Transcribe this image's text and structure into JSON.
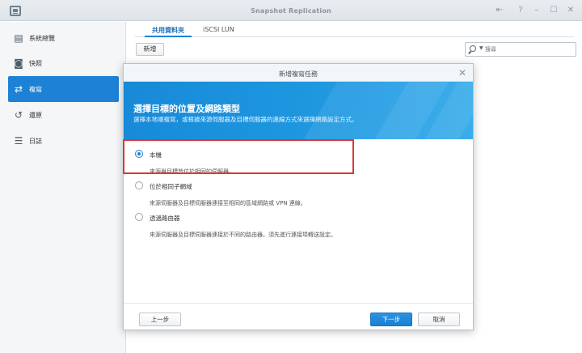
{
  "window": {
    "title": "Snapshot Replication",
    "controls": {
      "pin": "⇤",
      "help": "?",
      "minimize": "–",
      "maximize": "☐",
      "close": "✕"
    }
  },
  "sidebar": {
    "items": [
      {
        "label": "系統總覽",
        "icon": "overview-icon",
        "glyph": "▤",
        "active": false
      },
      {
        "label": "快照",
        "icon": "camera-icon",
        "glyph": "◙",
        "active": false
      },
      {
        "label": "複寫",
        "icon": "replication-icon",
        "glyph": "⇄",
        "active": true
      },
      {
        "label": "還原",
        "icon": "restore-icon",
        "glyph": "↺",
        "active": false
      },
      {
        "label": "日誌",
        "icon": "log-icon",
        "glyph": "☰",
        "active": false
      }
    ]
  },
  "content": {
    "tabs": [
      "共用資料夾",
      "iSCSI LUN"
    ],
    "add_label": "新增",
    "search_placeholder": "搜尋"
  },
  "dialog": {
    "title": "新增複寫任務",
    "close": "✕",
    "banner_title": "選擇目標的位置及網路類型",
    "banner_subtitle": "選擇本地端複寫，或根據來源伺服器及目標伺服器的連線方式來選擇網路設定方式。",
    "options": [
      {
        "label": "本機",
        "description": "來源與目標皆位於相同的伺服器。",
        "checked": true
      },
      {
        "label": "位於相同子網域",
        "description": "來源伺服器及目標伺服器連接至相同的區域網路或 VPN 連線。",
        "checked": false
      },
      {
        "label": "透過路由器",
        "description": "來源伺服器及目標伺服器連接於不同的路由器。須先進行連接埠轉送設定。",
        "checked": false
      }
    ],
    "buttons": {
      "back": "上一步",
      "next": "下一步",
      "cancel": "取消"
    }
  },
  "colors": {
    "accent": "#1d82d6",
    "highlight": "#d9383a",
    "banner": "#1f98e0"
  }
}
